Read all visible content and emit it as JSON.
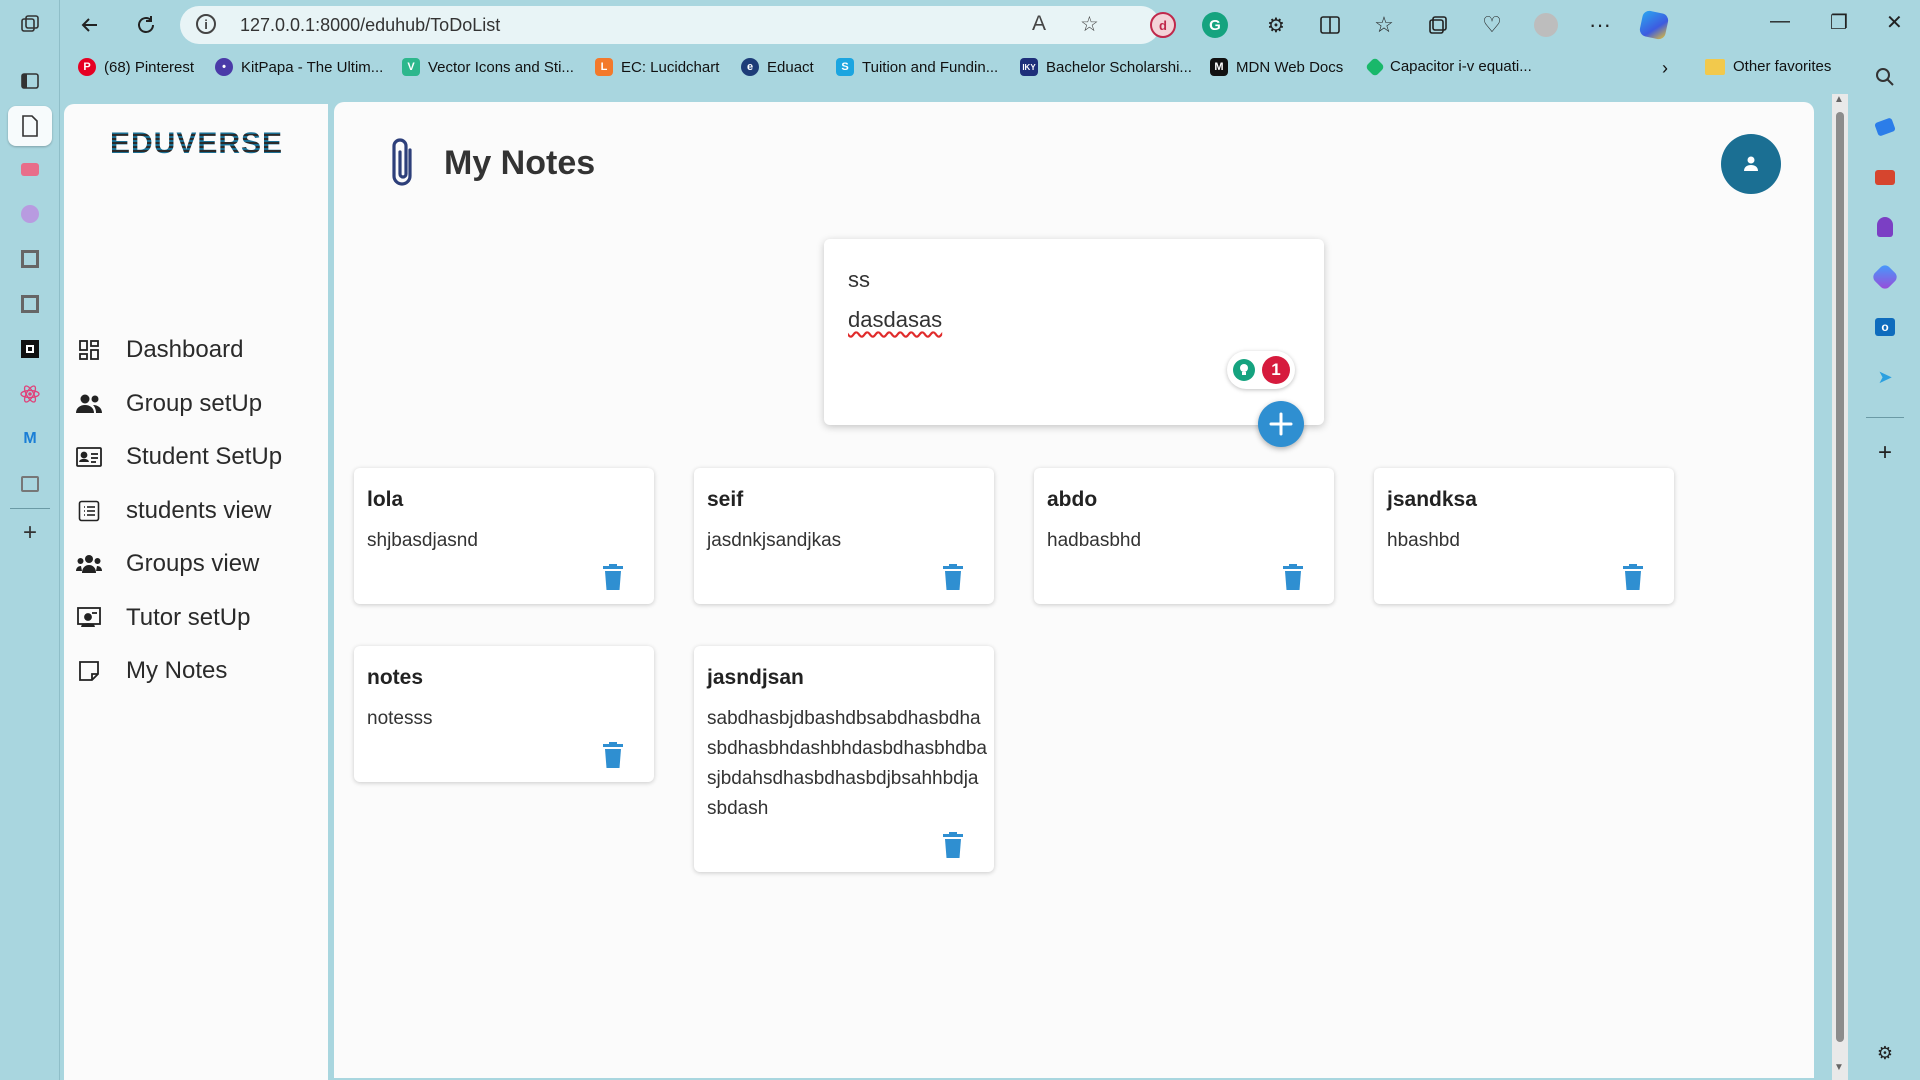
{
  "browser": {
    "url": "127.0.0.1:8000/eduhub/ToDoList",
    "bookmarks": [
      {
        "label": "(68) Pinterest",
        "color": "#e60023"
      },
      {
        "label": "KitPapa - The Ultim...",
        "color": "#4a3aa8"
      },
      {
        "label": "Vector Icons and Sti...",
        "color": "#2db78c"
      },
      {
        "label": "EC: Lucidchart",
        "color": "#f3792b"
      },
      {
        "label": "Eduact",
        "color": "#1d3c78"
      },
      {
        "label": "Tuition and Fundin...",
        "color": "#1ba5e0"
      },
      {
        "label": "Bachelor Scholarshi...",
        "color": "#1e2f7a"
      },
      {
        "label": "MDN Web Docs",
        "color": "#111111"
      },
      {
        "label": "Capacitor i-v equati...",
        "color": "#19b86a"
      }
    ],
    "other_favorites": "Other favorites"
  },
  "app": {
    "logo_text": "EDUVERSE",
    "nav": [
      {
        "label": "Dashboard",
        "icon": "dashboard-icon"
      },
      {
        "label": "Group setUp",
        "icon": "group-icon"
      },
      {
        "label": "Student SetUp",
        "icon": "id-card-icon"
      },
      {
        "label": "students view",
        "icon": "list-icon"
      },
      {
        "label": "Groups view",
        "icon": "groups-icon"
      },
      {
        "label": "Tutor setUp",
        "icon": "tutor-icon"
      },
      {
        "label": "My Notes",
        "icon": "note-icon"
      }
    ],
    "page_title": "My Notes",
    "composer": {
      "title": "ss",
      "body": "dasdasas",
      "grammar_count": "1"
    },
    "notes": [
      {
        "title": "lola",
        "body": "shjbasdjasnd"
      },
      {
        "title": "seif",
        "body": "jasdnkjsandjkas"
      },
      {
        "title": "abdo",
        "body": "hadbasbhd"
      },
      {
        "title": "jsandksa",
        "body": "hbashbd"
      },
      {
        "title": "notes",
        "body": "notesss"
      },
      {
        "title": "jasndjsan",
        "body": "sabdhasbjdbashdbsabdhasbdhasbdhasbhdashbhdasbdhasbhdbasjbdahsdhasbdhasbdjbsahhbdjasbdash"
      }
    ],
    "colors": {
      "primary": "#1b6f93",
      "accent": "#2f8fd1",
      "trash": "#2f8fd1"
    }
  }
}
